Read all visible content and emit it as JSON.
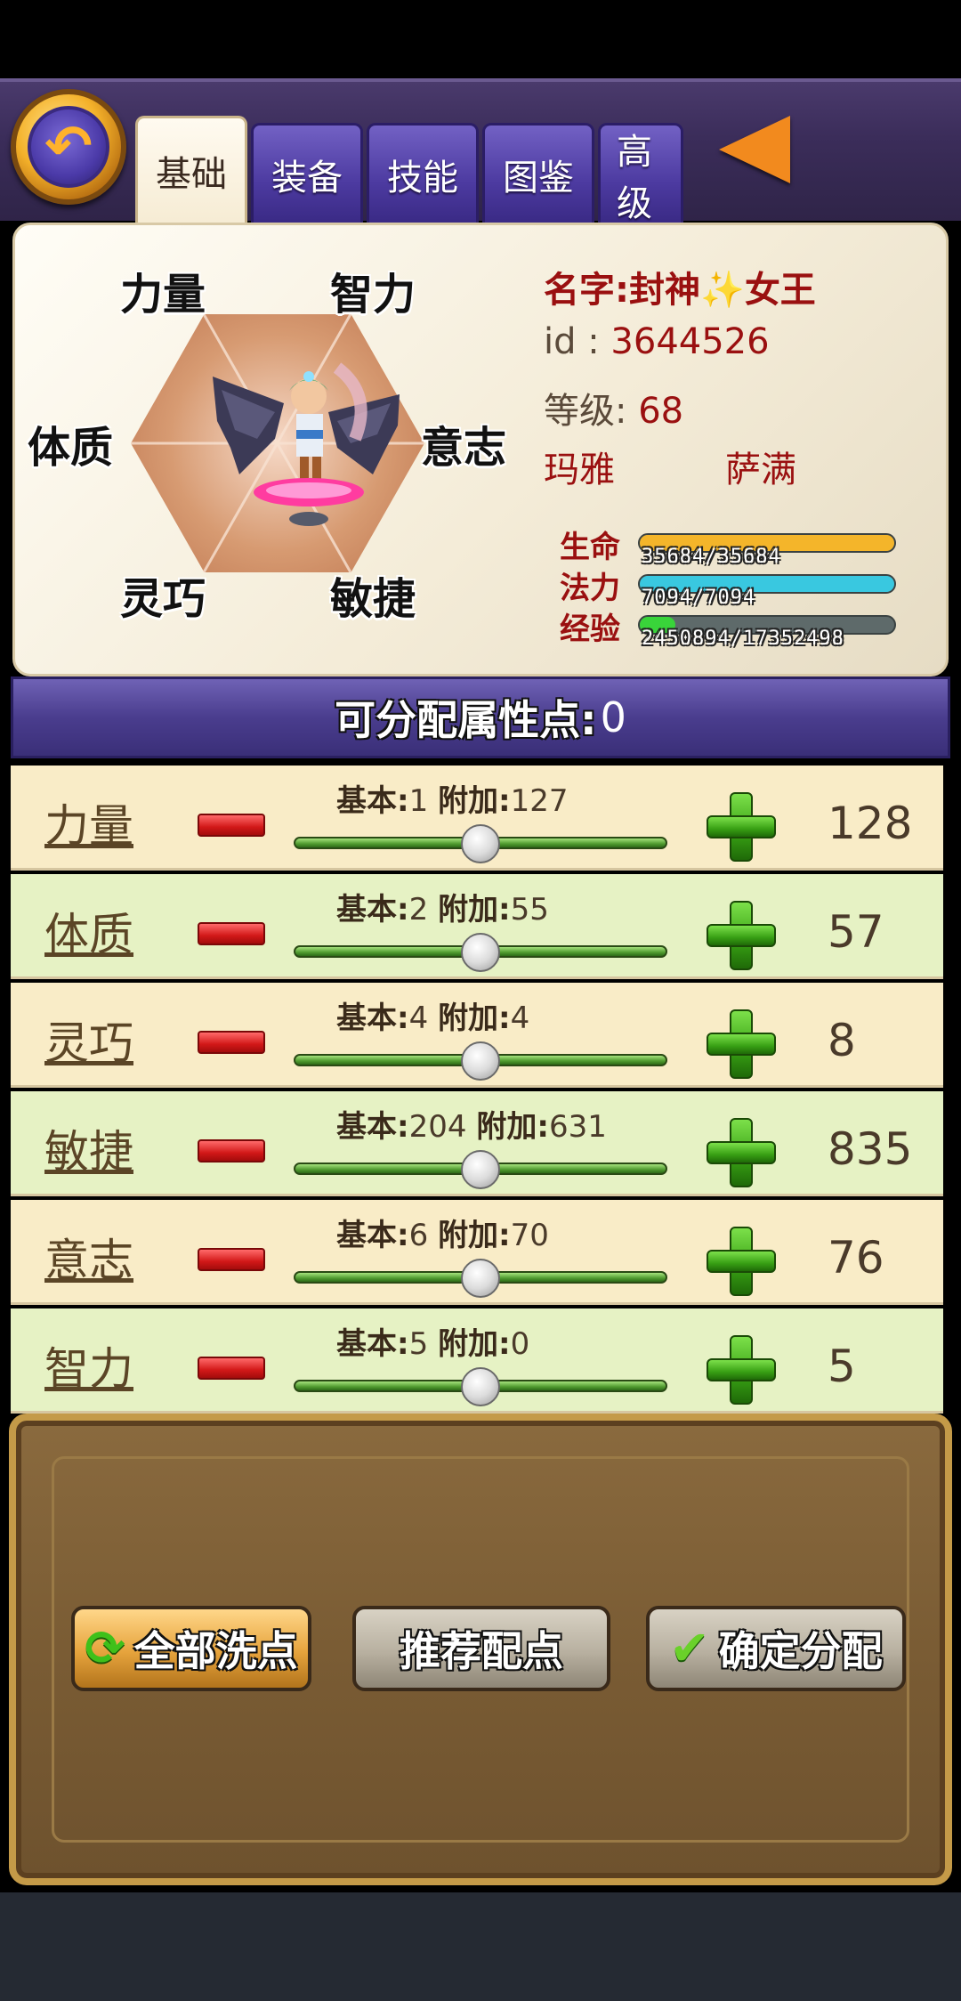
{
  "tabs": [
    {
      "label": "基础",
      "active": true
    },
    {
      "label": "装备",
      "active": false
    },
    {
      "label": "技能",
      "active": false
    },
    {
      "label": "图鉴",
      "active": false
    },
    {
      "label": "高级",
      "active": false
    }
  ],
  "hexagon": {
    "strength": "力量",
    "intelligence": "智力",
    "constitution": "体质",
    "will": "意志",
    "dexterity": "灵巧",
    "agility": "敏捷"
  },
  "profile": {
    "name_prefix": "名字:封神",
    "name_suffix": "女王",
    "sparkle": "✨",
    "id_label": "id : ",
    "id_value": "3644526",
    "level_label": "等级: ",
    "level_value": "68",
    "race": "玛雅",
    "class": "萨满"
  },
  "bars": {
    "hp": {
      "label": "生命",
      "text": "35684/35684",
      "fraction": 1.0,
      "color": "#f4b52a"
    },
    "mp": {
      "label": "法力",
      "text": "7094/7094",
      "fraction": 1.0,
      "color": "#39c8e0"
    },
    "exp": {
      "label": "经验",
      "text": "2450894/17352498",
      "fraction": 0.141,
      "color": "#39d43a"
    }
  },
  "points": {
    "label": "可分配属性点:",
    "value": "0"
  },
  "stats": [
    {
      "name": "力量",
      "base_label": "基本:",
      "base": "1",
      "bonus_label": "附加:",
      "bonus": "127",
      "total": "128"
    },
    {
      "name": "体质",
      "base_label": "基本:",
      "base": "2",
      "bonus_label": "附加:",
      "bonus": "55",
      "total": "57"
    },
    {
      "name": "灵巧",
      "base_label": "基本:",
      "base": "4",
      "bonus_label": "附加:",
      "bonus": "4",
      "total": "8"
    },
    {
      "name": "敏捷",
      "base_label": "基本:",
      "base": "204",
      "bonus_label": "附加:",
      "bonus": "631",
      "total": "835"
    },
    {
      "name": "意志",
      "base_label": "基本:",
      "base": "6",
      "bonus_label": "附加:",
      "bonus": "70",
      "total": "76"
    },
    {
      "name": "智力",
      "base_label": "基本:",
      "base": "5",
      "bonus_label": "附加:",
      "bonus": "0",
      "total": "5"
    }
  ],
  "slider_level": 0.5,
  "actions": {
    "reset": "全部洗点",
    "recommend": "推荐配点",
    "confirm": "确定分配"
  },
  "icons": {
    "back": "back-arrow-icon",
    "more": "left-arrow-icon",
    "reset": "refresh-icon",
    "confirm": "checkmark-icon"
  }
}
